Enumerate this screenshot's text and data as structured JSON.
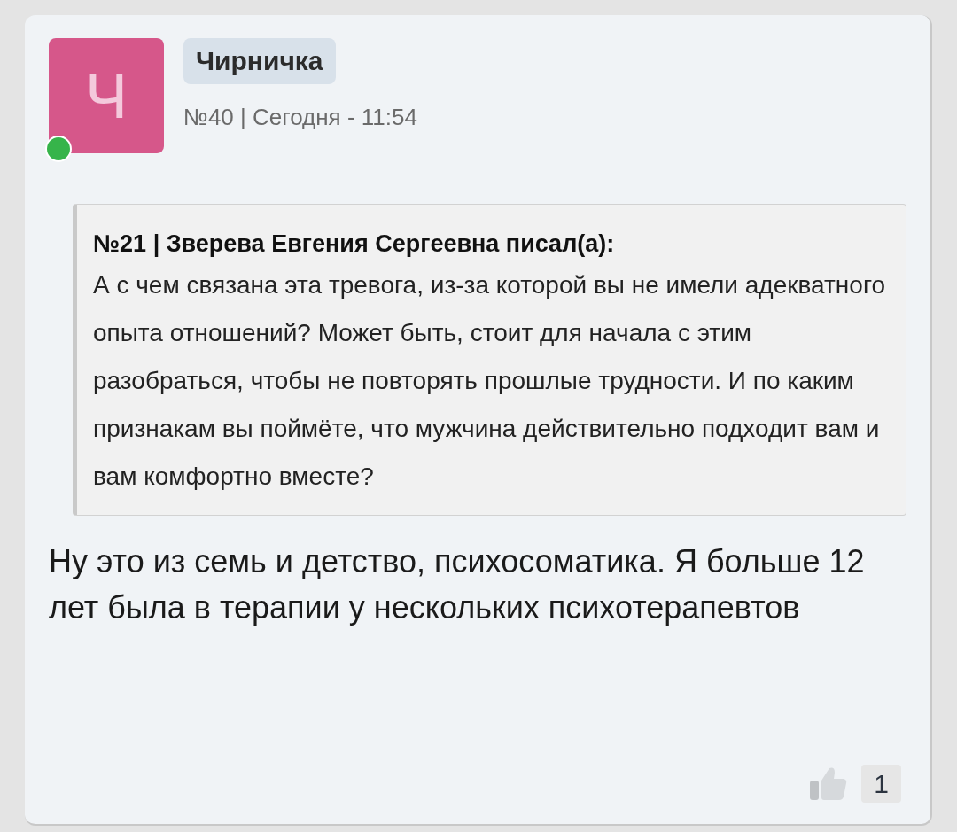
{
  "post": {
    "author": {
      "initial": "Ч",
      "name": "Чирничка",
      "online": true
    },
    "meta": "№40 | Сегодня - 11:54",
    "quote": {
      "header": "№21 | Зверева Евгения Сергеевна писал(а):",
      "text": "А с чем связана эта тревога, из-за которой вы не имели адекватного опыта отношений? Может быть, стоит для начала с этим разобраться, чтобы не повторять прошлые трудности. И по каким признакам вы поймёте, что мужчина действительно подходит вам и вам комфортно вместе?"
    },
    "body": "Ну это из семь и детство, психосоматика. Я больше 12 лет была в терапии у нескольких психотерапевтов",
    "likes": "1"
  }
}
